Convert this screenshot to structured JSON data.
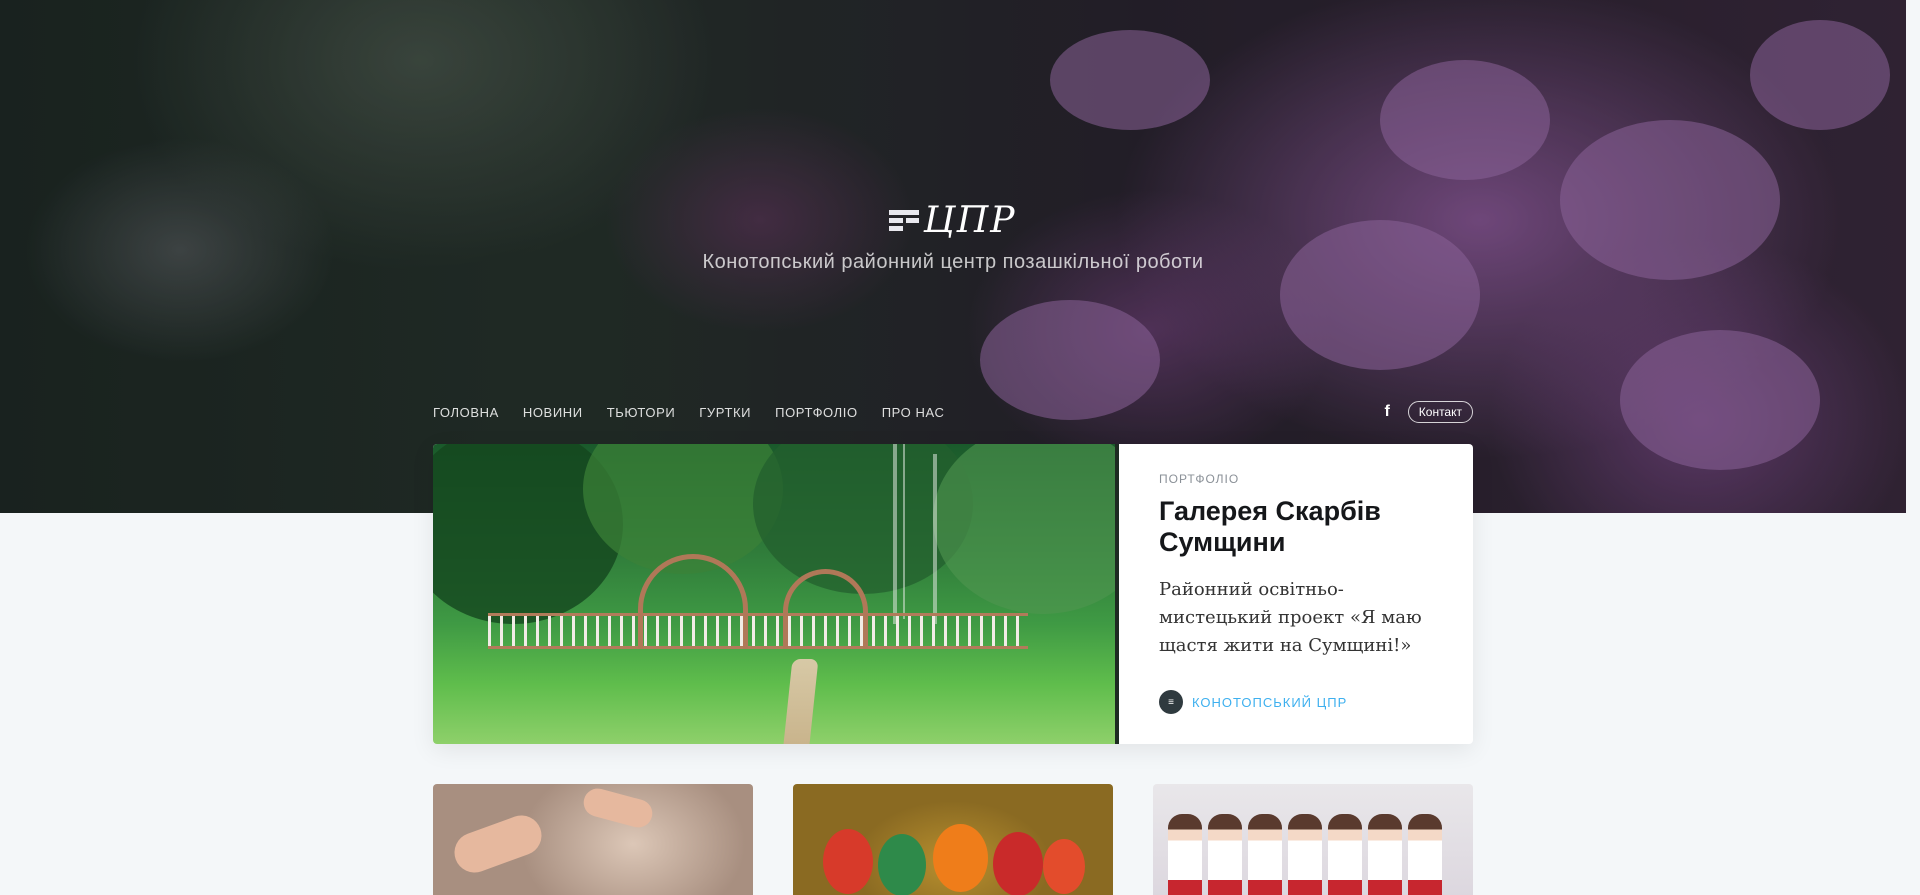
{
  "brand": {
    "logo_text": "ЦПР",
    "tagline": "Конотопський районний центр позашкільної роботи"
  },
  "nav": {
    "items": [
      {
        "label": "ГОЛОВНА"
      },
      {
        "label": "НОВИНИ"
      },
      {
        "label": "ТЬЮТОРИ"
      },
      {
        "label": "ГУРТКИ"
      },
      {
        "label": "ПОРТФОЛІО"
      },
      {
        "label": "ПРО НАС"
      }
    ],
    "facebook_icon": "f",
    "contact_label": "Контакт"
  },
  "featured": {
    "tag": "ПОРТФОЛІО",
    "title": "Галерея Скарбів Сумщини",
    "excerpt": "Районний освітньо-мистецький проект «Я маю щастя жити на Сумщині!»",
    "author_initials": "ЦПР",
    "author": "КОНОТОПСЬКИЙ ЦПР"
  },
  "colors": {
    "accent": "#3eb0ef",
    "page_bg": "#f4f7f9"
  }
}
